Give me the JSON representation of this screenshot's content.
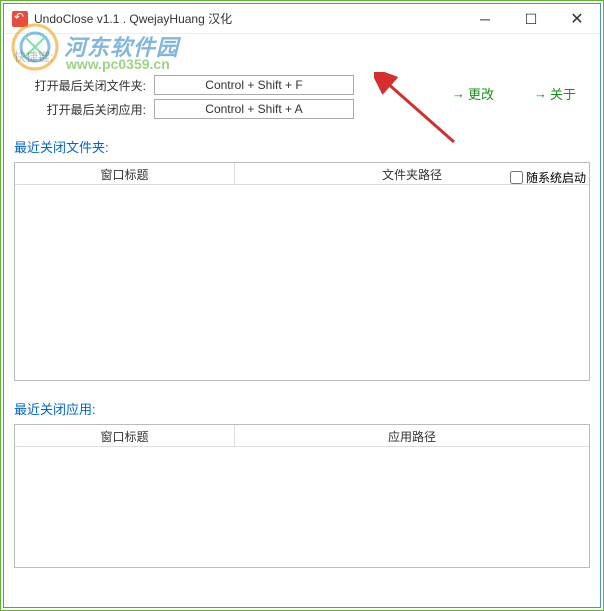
{
  "window": {
    "title": "UndoClose v1.1 . QwejayHuang 汉化"
  },
  "watermark": {
    "text1": "河东软件园",
    "text2": "www.pc0359.cn"
  },
  "shortcuts": {
    "header": "快捷键:",
    "row1": {
      "label": "打开最后关闭文件夹:",
      "value": "Control + Shift + F"
    },
    "row2": {
      "label": "打开最后关闭应用:",
      "value": "Control + Shift + A"
    }
  },
  "actions": {
    "change": "更改",
    "about": "关于"
  },
  "sections": {
    "folders": {
      "title": "最近关闭文件夹:",
      "col1": "窗口标题",
      "col2": "文件夹路径"
    },
    "apps": {
      "title": "最近关闭应用:",
      "col1": "窗口标题",
      "col2": "应用路径"
    }
  },
  "autostart": {
    "label": "随系统启动"
  }
}
